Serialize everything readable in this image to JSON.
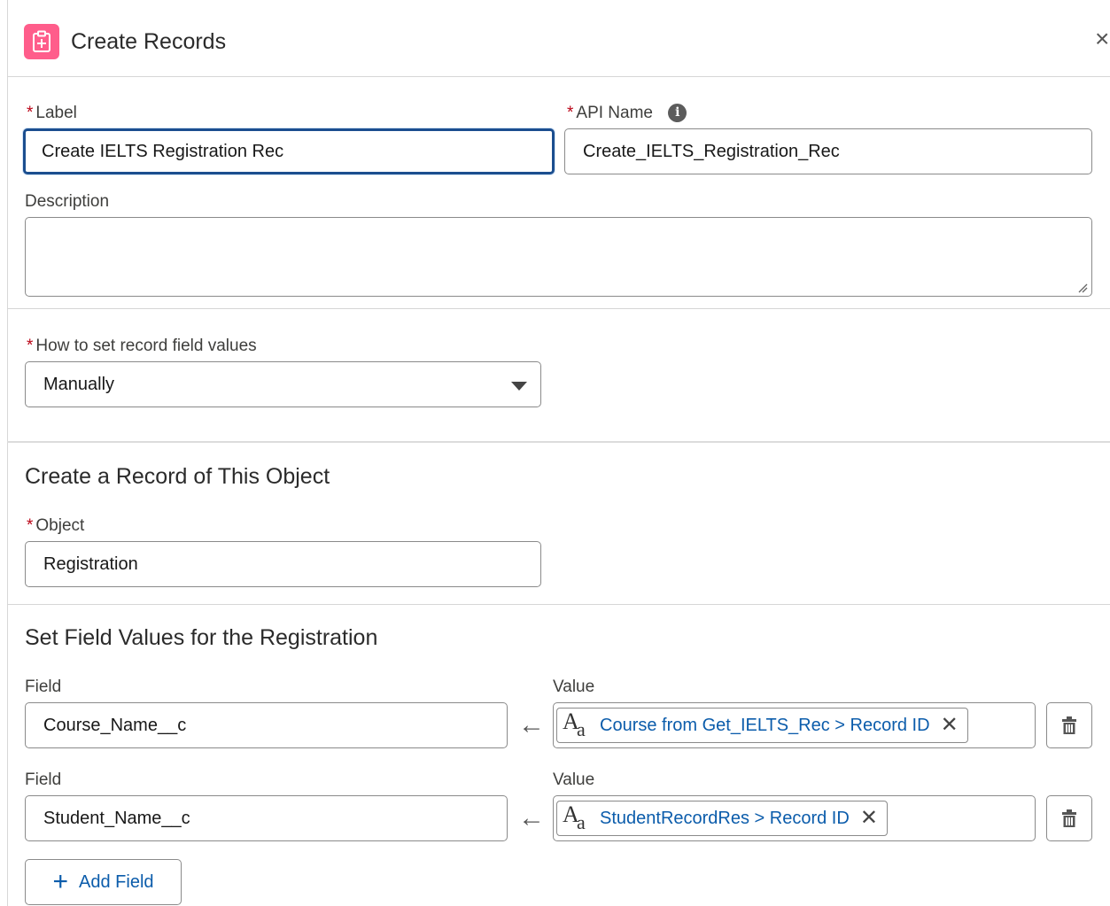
{
  "header": {
    "title": "Create Records",
    "close_label": "×"
  },
  "label_field": {
    "label": "Label",
    "value": "Create IELTS Registration Rec"
  },
  "api_name_field": {
    "label": "API Name",
    "value": "Create_IELTS_Registration_Rec",
    "info_glyph": "i"
  },
  "description_field": {
    "label": "Description",
    "value": ""
  },
  "how_to_set": {
    "label": "How to set record field values",
    "value": "Manually"
  },
  "object_section": {
    "title": "Create a Record of This Object",
    "object_label": "Object",
    "object_value": "Registration"
  },
  "field_values_section": {
    "title": "Set Field Values for the Registration",
    "rows": [
      {
        "field_label": "Field",
        "field_value": "Course_Name__c",
        "value_label": "Value",
        "value_pill": "Course from Get_IELTS_Rec > Record ID",
        "arrow": "←"
      },
      {
        "field_label": "Field",
        "field_value": "Student_Name__c",
        "value_label": "Value",
        "value_pill": "StudentRecordRes > Record ID",
        "arrow": "←"
      }
    ],
    "add_field_label": "Add Field",
    "add_field_glyph": "+"
  },
  "required_mark": "*",
  "icons": {
    "header": "create-records-icon",
    "info": "info-icon",
    "dropdown": "chevron-down-icon",
    "arrow": "arrow-left-icon",
    "text_type": "text-resource-icon",
    "remove": "close-icon",
    "delete": "trash-icon",
    "add": "plus-icon"
  },
  "colors": {
    "accent": "#0b5cab",
    "header_icon_bg": "#ff5d8b",
    "required": "#ba0517",
    "focus_border": "#1b4e8f"
  },
  "glyphs": {
    "text_type_big": "A",
    "text_type_small": "a",
    "remove": "✕"
  }
}
